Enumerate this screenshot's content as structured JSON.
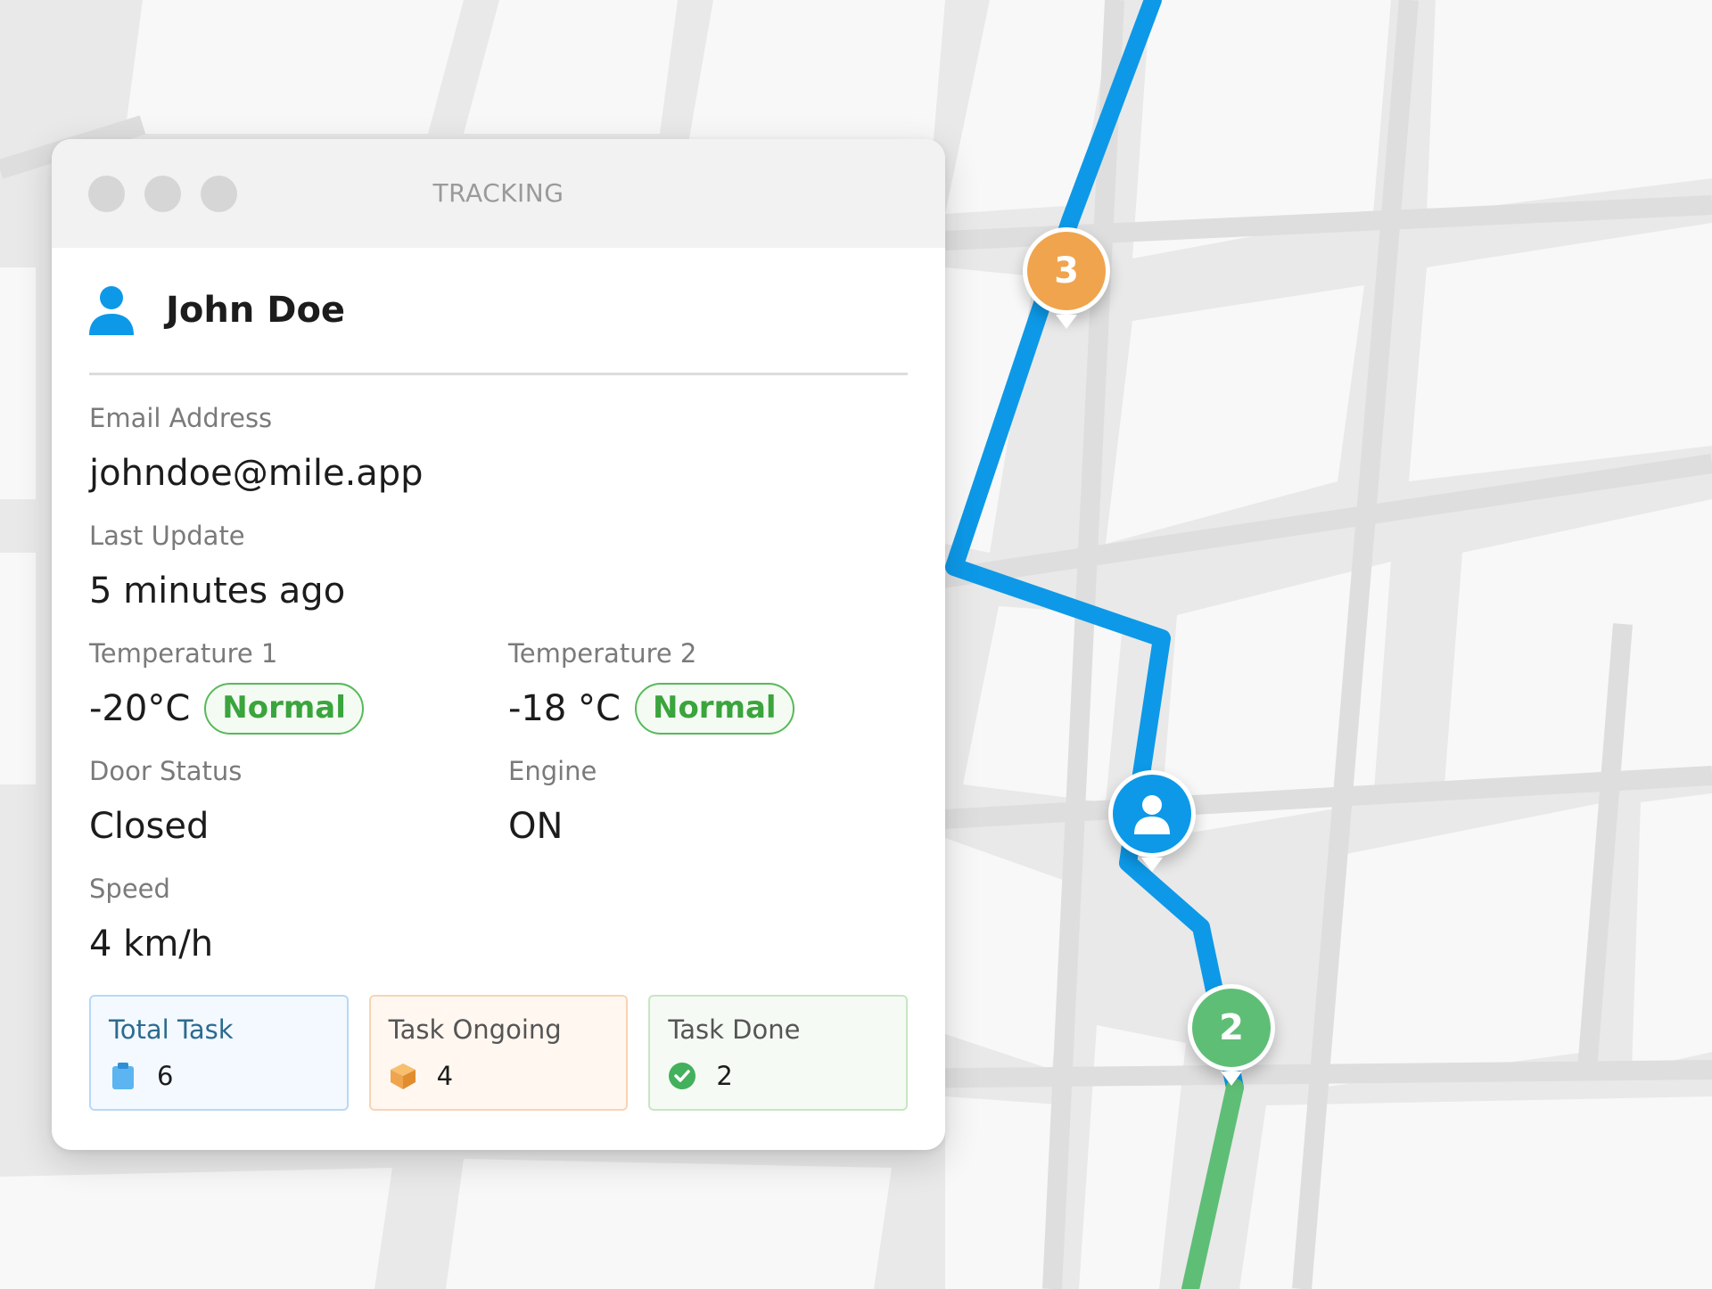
{
  "window": {
    "title": "TRACKING"
  },
  "user": {
    "name": "John Doe"
  },
  "fields": {
    "email": {
      "label": "Email Address",
      "value": "johndoe@mile.app"
    },
    "last_update": {
      "label": "Last Update",
      "value": "5 minutes ago"
    },
    "temperature1": {
      "label": "Temperature 1",
      "value": "-20°C",
      "status": "Normal"
    },
    "temperature2": {
      "label": "Temperature 2",
      "value": "-18 °C",
      "status": "Normal"
    },
    "door_status": {
      "label": "Door Status",
      "value": "Closed"
    },
    "engine": {
      "label": "Engine",
      "value": "ON"
    },
    "speed": {
      "label": "Speed",
      "value": "4 km/h"
    }
  },
  "summary": {
    "total_task": {
      "label": "Total Task",
      "value": "6",
      "icon": "clipboard-icon"
    },
    "task_ongoing": {
      "label": "Task Ongoing",
      "value": "4",
      "icon": "box-icon"
    },
    "task_done": {
      "label": "Task Done",
      "value": "2",
      "icon": "check-circle-icon"
    }
  },
  "map": {
    "markers": [
      {
        "label": "3",
        "color": "#f0a44e"
      },
      {
        "label": "",
        "icon": "user-icon",
        "color": "#0d99e8"
      },
      {
        "label": "2",
        "color": "#5fbe76"
      }
    ],
    "route_color": "#0d99e8",
    "done_route_color": "#5fbe76"
  },
  "colors": {
    "accent": "#0d99e8",
    "status_normal": "#3aa43d"
  }
}
